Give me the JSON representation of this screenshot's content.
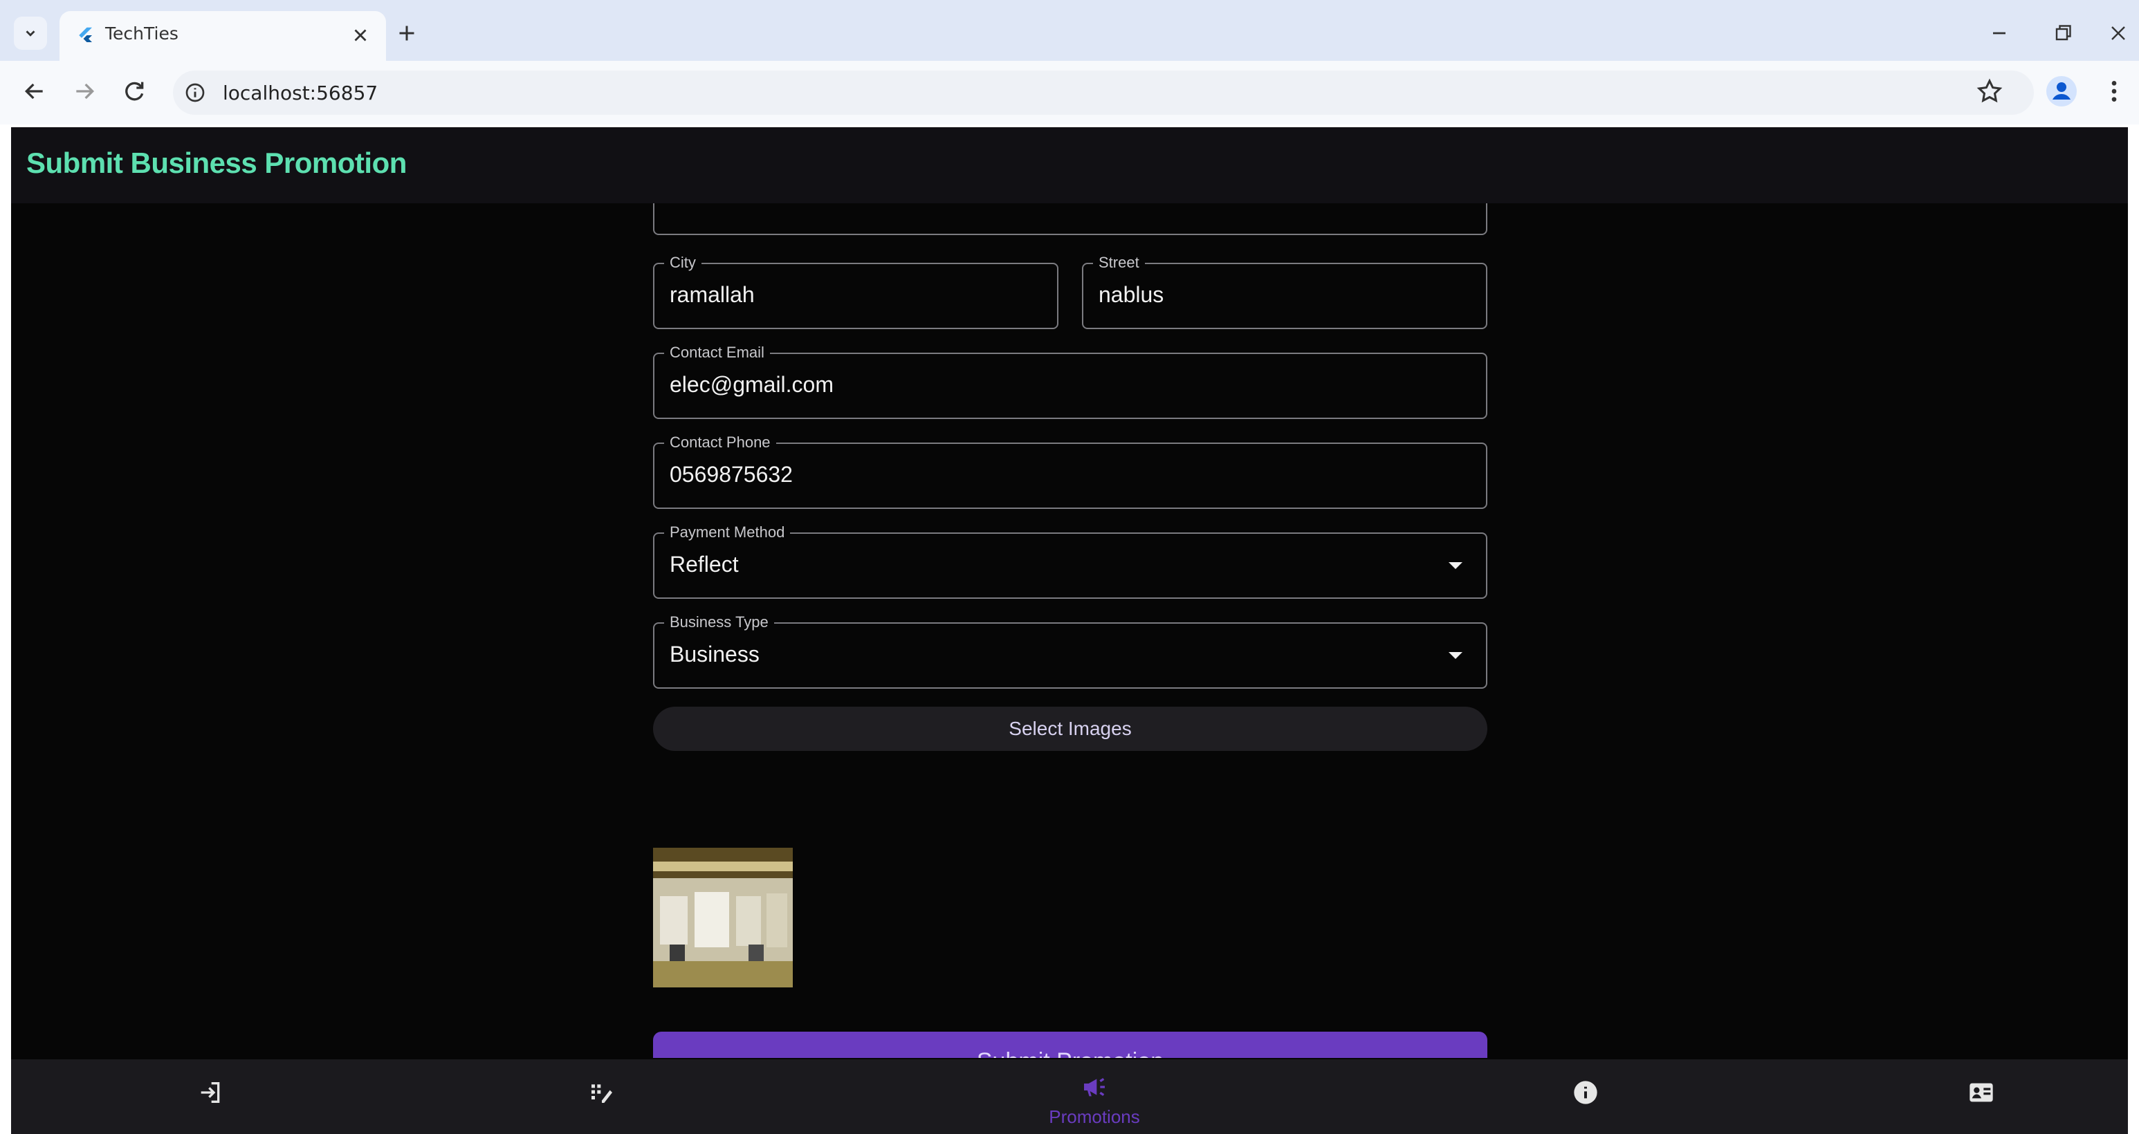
{
  "browser": {
    "tab_title": "TechTies",
    "url": "localhost:56857"
  },
  "app": {
    "title": "Submit Business Promotion",
    "form": {
      "city": {
        "label": "City",
        "value": "ramallah"
      },
      "street": {
        "label": "Street",
        "value": "nablus"
      },
      "contact_email": {
        "label": "Contact Email",
        "value": "elec@gmail.com"
      },
      "contact_phone": {
        "label": "Contact Phone",
        "value": "0569875632"
      },
      "payment_method": {
        "label": "Payment Method",
        "value": "Reflect"
      },
      "business_type": {
        "label": "Business Type",
        "value": "Business"
      },
      "select_images_label": "Select Images",
      "submit_label": "Submit Promotion"
    },
    "bottom_nav": [
      {
        "icon": "login-icon"
      },
      {
        "icon": "edit-list-icon"
      },
      {
        "icon": "campaign-icon",
        "label": "Promotions",
        "active": true
      },
      {
        "icon": "info-icon"
      },
      {
        "icon": "contact-card-icon"
      }
    ],
    "colors": {
      "title": "#5de0b0",
      "accent": "#6a3cc0",
      "background": "#060606"
    }
  }
}
